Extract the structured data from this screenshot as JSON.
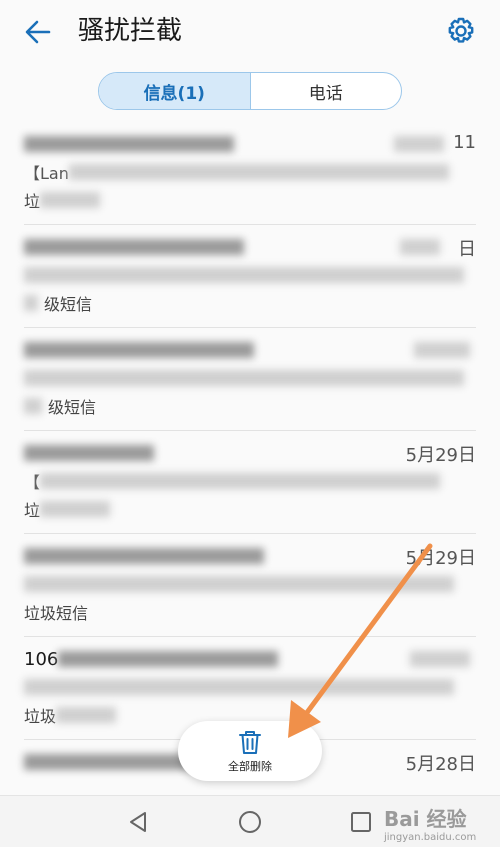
{
  "header": {
    "title": "骚扰拦截"
  },
  "tabs": [
    {
      "label": "信息(1)",
      "active": true
    },
    {
      "label": "电话",
      "active": false
    }
  ],
  "messages": [
    {
      "sender": "",
      "date": "11",
      "snippet": "【Lan",
      "folder": "垃"
    },
    {
      "sender": "",
      "date": "日",
      "snippet": "",
      "folder": "级短信"
    },
    {
      "sender": "",
      "date": "",
      "snippet": "",
      "folder": "级短信"
    },
    {
      "sender": "",
      "date": "5月29日",
      "snippet": "【",
      "folder": "垃"
    },
    {
      "sender": "",
      "date": "5月29日",
      "snippet": "",
      "folder": "垃圾短信"
    },
    {
      "sender": "106",
      "date": "",
      "snippet": "",
      "folder": "垃圾"
    },
    {
      "sender": "",
      "date": "5月28日",
      "snippet": "",
      "folder": ""
    }
  ],
  "fab": {
    "label": "全部删除"
  },
  "watermark": {
    "text": "Bai 经验",
    "url": "jingyan.baidu.com"
  },
  "colors": {
    "accent": "#1a6fb8",
    "arrow": "#f0904a"
  }
}
